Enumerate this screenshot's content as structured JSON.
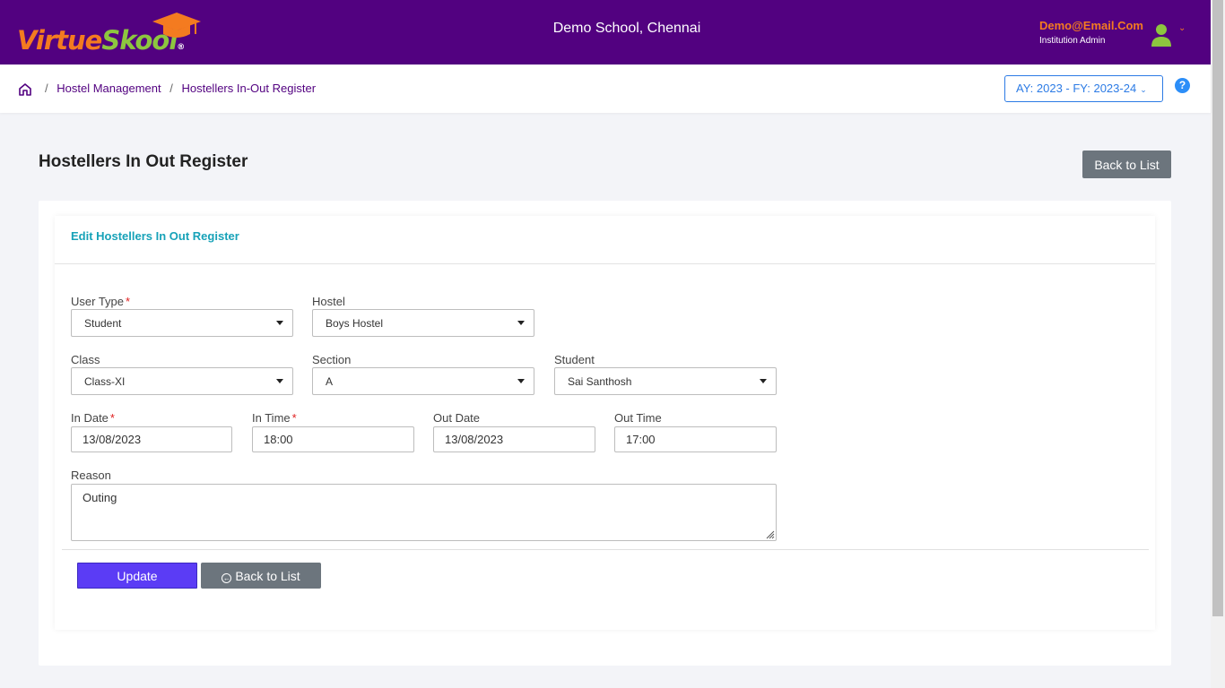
{
  "header": {
    "logo_virtue": "Virtue",
    "logo_skool": "Skool",
    "logo_reg": "®",
    "school_name": "Demo School, Chennai",
    "user_email": "Demo@Email.Com",
    "user_role": "Institution Admin"
  },
  "breadcrumb": {
    "items": [
      "Hostel Management",
      "Hostellers In-Out Register"
    ],
    "separator": "/"
  },
  "academic_year": "AY: 2023 - FY: 2023-24",
  "help_label": "?",
  "page": {
    "title": "Hostellers In Out Register",
    "back_to_list": "Back to List"
  },
  "form": {
    "header": "Edit Hostellers In Out Register",
    "user_type": {
      "label": "User Type",
      "value": "Student",
      "required": "*"
    },
    "hostel": {
      "label": "Hostel",
      "value": "Boys Hostel"
    },
    "class": {
      "label": "Class",
      "value": "Class-XI"
    },
    "section": {
      "label": "Section",
      "value": "A"
    },
    "student": {
      "label": "Student",
      "value": "Sai Santhosh"
    },
    "in_date": {
      "label": "In Date",
      "value": "13/08/2023",
      "required": "*"
    },
    "in_time": {
      "label": "In Time",
      "value": "18:00",
      "required": "*"
    },
    "out_date": {
      "label": "Out Date",
      "value": "13/08/2023"
    },
    "out_time": {
      "label": "Out Time",
      "value": "17:00"
    },
    "reason": {
      "label": "Reason",
      "value": "Outing"
    },
    "update_button": "Update",
    "back_button": "Back to List"
  },
  "colors": {
    "header_bg": "#520180",
    "accent_orange": "#f47b20",
    "accent_green": "#8dc63f",
    "link_blue": "#2c7be5",
    "card_header": "#17a2b8",
    "update_btn": "#5b3cf5",
    "gray_btn": "#6c757d"
  },
  "icons": [
    "graduation-cap-icon",
    "user-avatar-icon",
    "chevron-down-icon",
    "home-icon",
    "help-icon",
    "caret-down-icon",
    "back-arrow-circle-icon",
    "resize-grip-icon"
  ]
}
